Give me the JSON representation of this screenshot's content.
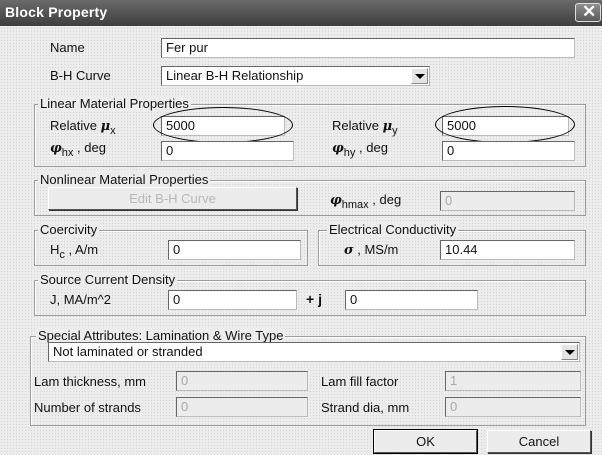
{
  "window": {
    "title": "Block Property",
    "close_glyph": "✕",
    "close_icon": "close-icon"
  },
  "general": {
    "name_label": "Name",
    "name_value": "Fer pur",
    "bh_label": "B-H Curve",
    "bh_selected": "Linear B-H Relationship"
  },
  "linear": {
    "legend": "Linear Material Properties",
    "rel_x_label": "Relative",
    "rel_x_symbol": "μ",
    "rel_x_sub": "x",
    "rel_x_value": "5000",
    "rel_y_label": "Relative",
    "rel_y_symbol": "μ",
    "rel_y_sub": "y",
    "rel_y_value": "5000",
    "phi_hx_symbol": "φ",
    "phi_hx_sub": "hx",
    "phi_hx_unit": ", deg",
    "phi_hx_value": "0",
    "phi_hy_symbol": "φ",
    "phi_hy_sub": "hy",
    "phi_hy_unit": ", deg",
    "phi_hy_value": "0"
  },
  "nonlinear": {
    "legend": "Nonlinear Material Properties",
    "edit_bh_button": "Edit B-H Curve",
    "phi_hmax_symbol": "φ",
    "phi_hmax_sub": "hmax",
    "phi_hmax_unit": ", deg",
    "phi_hmax_value": "0"
  },
  "coercivity": {
    "legend": "Coercivity",
    "symbol": "H",
    "sub": "c",
    "unit": ", A/m",
    "value": "0"
  },
  "conductivity": {
    "legend": "Electrical Conductivity",
    "symbol": "σ",
    "unit": ", MS/m",
    "value": "10.44"
  },
  "source": {
    "legend": "Source Current Density",
    "label": "J, MA/m^2",
    "real_value": "0",
    "plus_j": "+ j",
    "imag_value": "0"
  },
  "special": {
    "legend": "Special Attributes:  Lamination & Wire Type",
    "type_selected": "Not laminated or stranded",
    "lam_thickness_label": "Lam thickness, mm",
    "lam_thickness_value": "0",
    "lam_fill_label": "Lam fill factor",
    "lam_fill_value": "1",
    "strands_label": "Number of strands",
    "strands_value": "0",
    "strand_dia_label": "Strand dia, mm",
    "strand_dia_value": "0"
  },
  "actions": {
    "ok": "OK",
    "cancel": "Cancel"
  }
}
